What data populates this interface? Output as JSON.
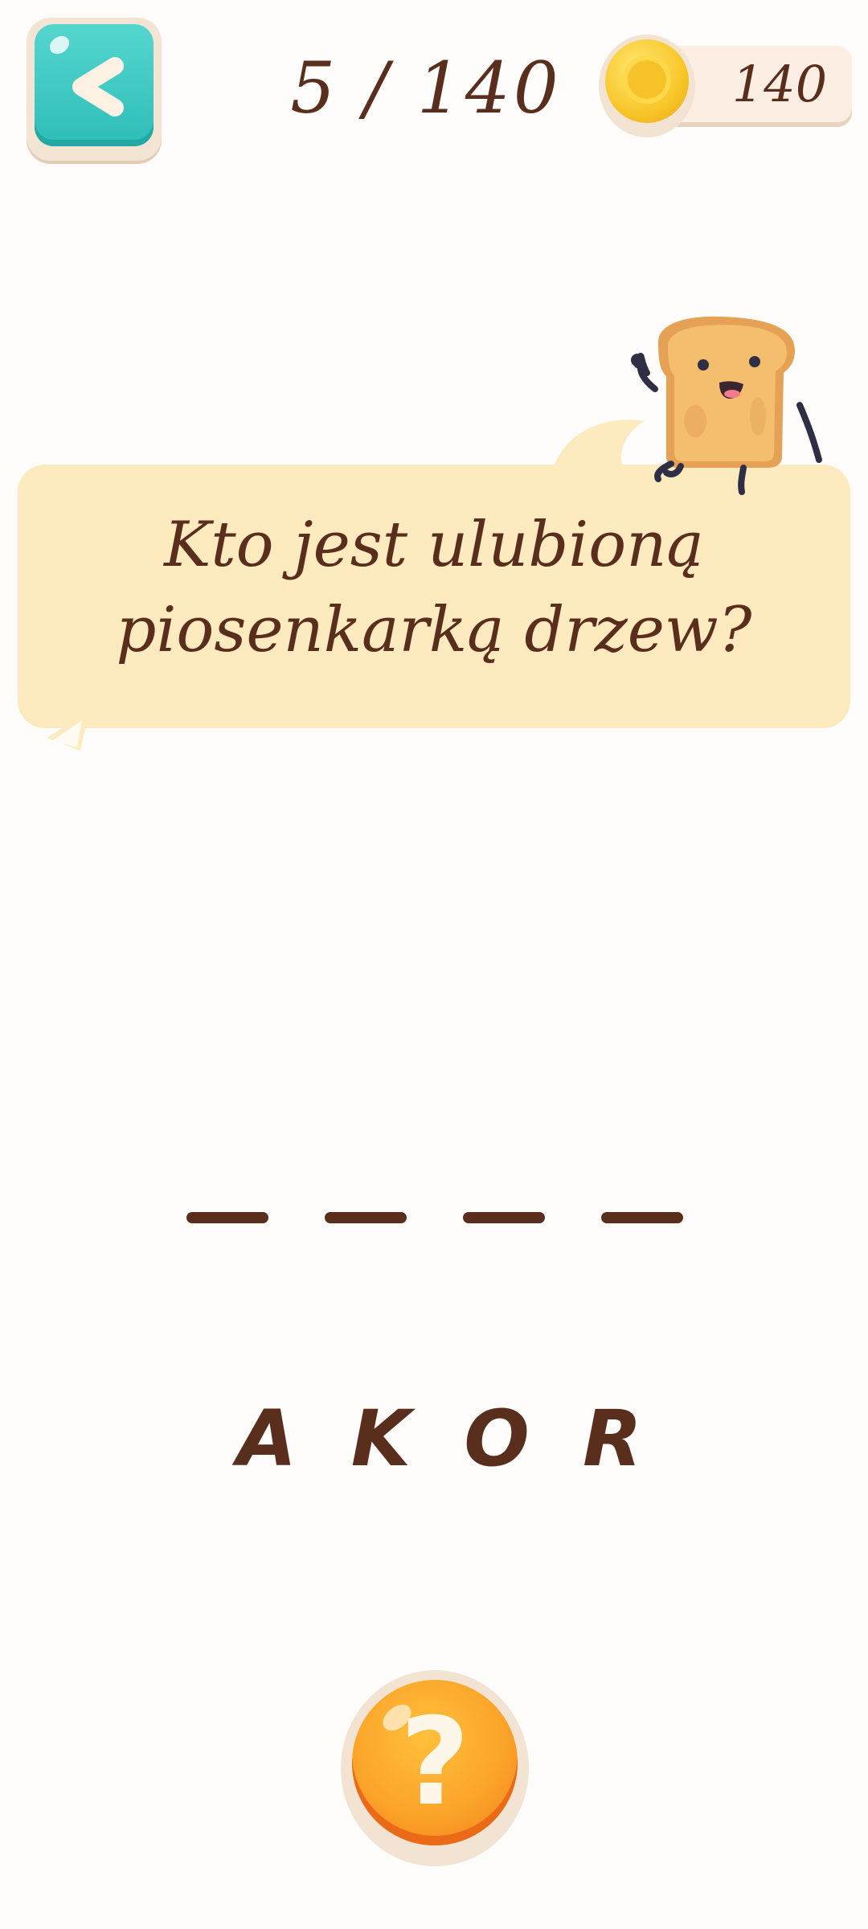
{
  "header": {
    "back_icon": "chevron-left-icon",
    "level_text": "5 / 140",
    "coins": "140",
    "coin_icon": "coin-icon"
  },
  "question": {
    "line1": "Kto jest ulubioną",
    "line2": "piosenkarką drzew?"
  },
  "answer": {
    "slot_count": 4
  },
  "letters": [
    "A",
    "K",
    "O",
    "R"
  ],
  "hint": {
    "symbol": "?"
  },
  "colors": {
    "text": "#5a2e1d",
    "back_button": "#2ebdb8",
    "bubble": "#fdeabe",
    "hint_button": "#fba42a",
    "coin": "#f8c629"
  }
}
